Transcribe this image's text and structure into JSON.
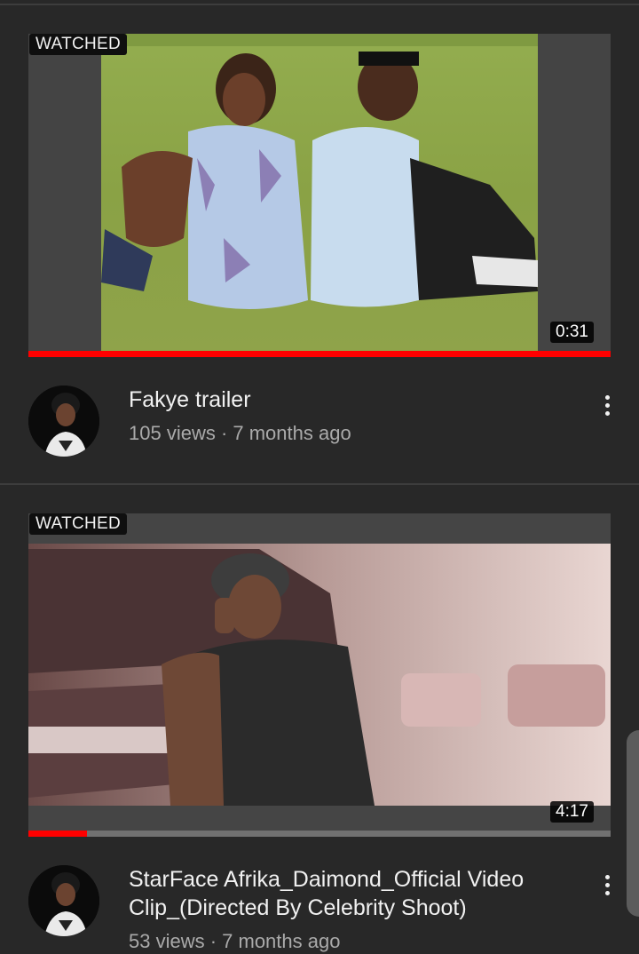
{
  "videos": [
    {
      "badge": "WATCHED",
      "duration": "0:31",
      "progress": 1.0,
      "title": "Fakye trailer",
      "meta": "105 views · 7 months ago",
      "menu_icon": "more-vert-icon"
    },
    {
      "badge": "WATCHED",
      "duration": "4:17",
      "progress": 0.1,
      "title": "StarFace Afrika_Daimond_Official Video Clip_(Directed By Celebrity Shoot)",
      "meta": "53 views · 7 months ago",
      "menu_icon": "more-vert-icon"
    }
  ],
  "colors": {
    "background": "#282828",
    "progress": "#ff0000",
    "progress_track": "#717171",
    "meta_text": "#aaaaaa"
  }
}
